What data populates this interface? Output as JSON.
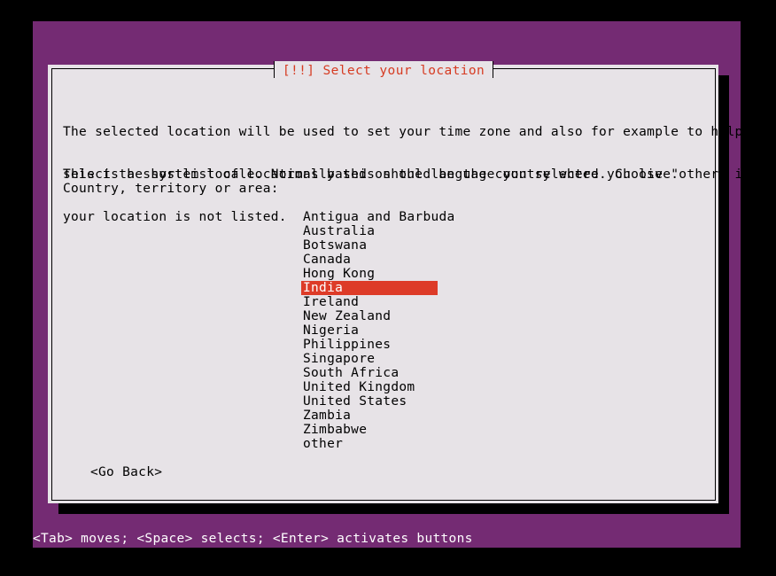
{
  "theme": {
    "backdrop_purple": "#742b73",
    "dialog_background": "#e7e3e7",
    "title_red": "#d63b22",
    "highlight_red": "#dd3b28",
    "highlight_text": "#ffffff",
    "border_black": "#000000",
    "status_text": "#ffffff"
  },
  "dialog": {
    "title": "[!!] Select your location",
    "intro_paragraph": [
      "The selected location will be used to set your time zone and also for example to help",
      "select the system locale. Normally this should be the country where you live."
    ],
    "shortlist_paragraph": [
      "This is a shortlist of locations based on the language you selected. Choose \"other\" if",
      "your location is not listed."
    ],
    "prompt_label": "Country, territory or area:",
    "countries": [
      {
        "label": "Antigua and Barbuda",
        "selected": false
      },
      {
        "label": "Australia",
        "selected": false
      },
      {
        "label": "Botswana",
        "selected": false
      },
      {
        "label": "Canada",
        "selected": false
      },
      {
        "label": "Hong Kong",
        "selected": false
      },
      {
        "label": "India",
        "selected": true
      },
      {
        "label": "Ireland",
        "selected": false
      },
      {
        "label": "New Zealand",
        "selected": false
      },
      {
        "label": "Nigeria",
        "selected": false
      },
      {
        "label": "Philippines",
        "selected": false
      },
      {
        "label": "Singapore",
        "selected": false
      },
      {
        "label": "South Africa",
        "selected": false
      },
      {
        "label": "United Kingdom",
        "selected": false
      },
      {
        "label": "United States",
        "selected": false
      },
      {
        "label": "Zambia",
        "selected": false
      },
      {
        "label": "Zimbabwe",
        "selected": false
      },
      {
        "label": "other",
        "selected": false
      }
    ],
    "selected_country": "India",
    "go_back_button": "<Go Back>"
  },
  "status_bar": {
    "hint": "<Tab> moves; <Space> selects; <Enter> activates buttons"
  }
}
